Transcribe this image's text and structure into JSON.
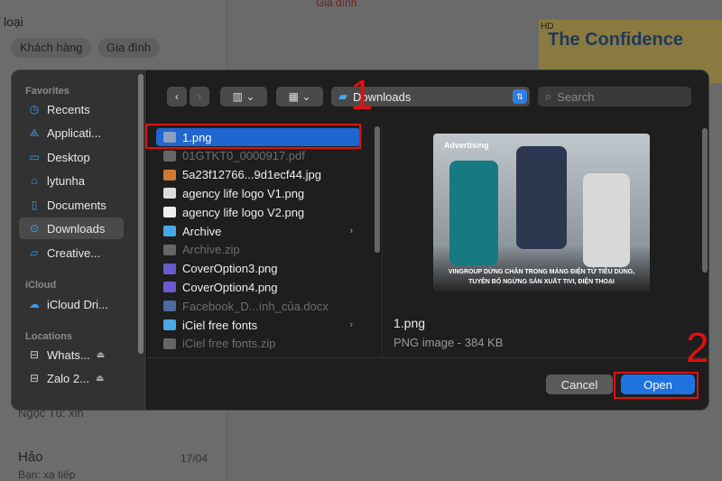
{
  "background": {
    "title": "loại",
    "chips": [
      "Khách hàng",
      "Gia đình"
    ],
    "top_link": "Gia đình",
    "ad": {
      "badge": "HD",
      "text": "The Confidence"
    },
    "chats": [
      {
        "name": "Ngọc Tú: xin"
      },
      {
        "name": "Hảo",
        "date": "17/04",
        "preview": "Bạn: xạ tiếp"
      }
    ]
  },
  "sidebar": {
    "favorites_label": "Favorites",
    "favorites": [
      {
        "label": "Recents",
        "icon": "clock-icon"
      },
      {
        "label": "Applicati...",
        "icon": "apps-icon"
      },
      {
        "label": "Desktop",
        "icon": "desktop-icon"
      },
      {
        "label": "lytunha",
        "icon": "home-icon"
      },
      {
        "label": "Documents",
        "icon": "document-icon"
      },
      {
        "label": "Downloads",
        "icon": "download-icon",
        "active": true
      },
      {
        "label": "Creative...",
        "icon": "folder-icon"
      }
    ],
    "icloud_label": "iCloud",
    "icloud": [
      {
        "label": "iCloud Dri...",
        "icon": "cloud-icon"
      }
    ],
    "locations_label": "Locations",
    "locations": [
      {
        "label": "Whats...",
        "icon": "drive-icon"
      },
      {
        "label": "Zalo 2...",
        "icon": "drive-icon"
      }
    ]
  },
  "toolbar": {
    "location": "Downloads",
    "search_placeholder": "Search"
  },
  "files": [
    {
      "name": "1.png",
      "selected": true,
      "color": "#8aa0c0"
    },
    {
      "name": "01GTKT0_0000917.pdf",
      "dim": true,
      "color": "#666"
    },
    {
      "name": "5a23f12766...9d1ecf44.jpg",
      "color": "#d07a30"
    },
    {
      "name": "agency life logo V1.png",
      "color": "#ddd"
    },
    {
      "name": "agency life logo V2.png",
      "color": "#eee"
    },
    {
      "name": "Archive",
      "folder": true,
      "color": "#4aa8e8"
    },
    {
      "name": "Archive.zip",
      "dim": true,
      "color": "#666"
    },
    {
      "name": "CoverOption3.png",
      "color": "#6a5ad0"
    },
    {
      "name": "CoverOption4.png",
      "color": "#6a5ad0"
    },
    {
      "name": "Facebook_D...ính_của.docx",
      "dim": true,
      "color": "#4a6aa0"
    },
    {
      "name": "iCiel free fonts",
      "folder": true,
      "color": "#4aa8e8"
    },
    {
      "name": "iCiel free fonts.zip",
      "dim": true,
      "color": "#666"
    }
  ],
  "preview": {
    "brand": "Advertising",
    "caption_line1": "VINGROUP DỪNG CHÂN TRONG MẢNG ĐIỆN TỬ TIÊU DÙNG,",
    "caption_line2": "TUYÊN BỐ NGỪNG SẢN XUẤT TIVI, ĐIỆN THOẠI",
    "name": "1.png",
    "info": "PNG image - 384 KB"
  },
  "buttons": {
    "cancel": "Cancel",
    "open": "Open"
  },
  "annotations": {
    "step1": "1",
    "step2": "2"
  }
}
